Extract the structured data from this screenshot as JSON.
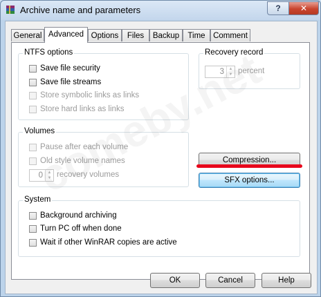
{
  "window": {
    "title": "Archive name and parameters",
    "help_glyph": "?",
    "close_glyph": "✕"
  },
  "tabs": [
    {
      "label": "General"
    },
    {
      "label": "Advanced"
    },
    {
      "label": "Options"
    },
    {
      "label": "Files"
    },
    {
      "label": "Backup"
    },
    {
      "label": "Time"
    },
    {
      "label": "Comment"
    }
  ],
  "active_tab": "Advanced",
  "ntfs": {
    "title": "NTFS options",
    "items": [
      {
        "label": "Save file security",
        "checked": false,
        "enabled": true
      },
      {
        "label": "Save file streams",
        "checked": false,
        "enabled": true
      },
      {
        "label": "Store symbolic links as links",
        "checked": false,
        "enabled": false
      },
      {
        "label": "Store hard links as links",
        "checked": false,
        "enabled": false
      }
    ]
  },
  "recovery": {
    "title": "Recovery record",
    "value": "3",
    "unit": "percent"
  },
  "volumes": {
    "title": "Volumes",
    "items": [
      {
        "label": "Pause after each volume",
        "checked": false,
        "enabled": false
      },
      {
        "label": "Old style volume names",
        "checked": false,
        "enabled": false
      }
    ],
    "recovery_volumes_value": "0",
    "recovery_volumes_label": "recovery volumes"
  },
  "buttons": {
    "compression": "Compression...",
    "sfx": "SFX options...",
    "ok": "OK",
    "cancel": "Cancel",
    "help": "Help"
  },
  "system": {
    "title": "System",
    "items": [
      {
        "label": "Background archiving",
        "checked": false,
        "enabled": true
      },
      {
        "label": "Turn PC off when done",
        "checked": false,
        "enabled": true
      },
      {
        "label": "Wait if other WinRAR copies are active",
        "checked": false,
        "enabled": true
      }
    ]
  },
  "watermark": "comeby.net",
  "colors": {
    "highlight_underline": "#e8061b",
    "focused_button": "#bee6fd"
  }
}
